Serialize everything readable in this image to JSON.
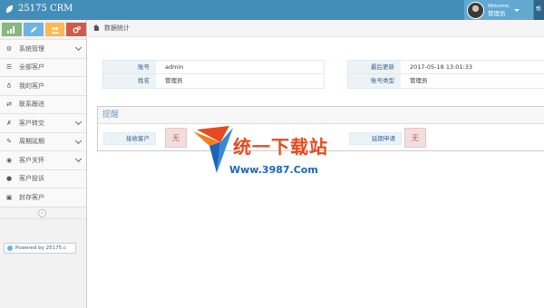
{
  "app": {
    "title": "25175 CRM"
  },
  "user": {
    "welcome": "Welcome,",
    "name": "管理员",
    "extra": "帮"
  },
  "shortcuts": [
    "bar-chart-icon",
    "pencil-icon",
    "users-icon",
    "cogs-icon"
  ],
  "sidebar": {
    "items": [
      {
        "label": "系统管理",
        "icon": "gear-icon",
        "has_submenu": true
      },
      {
        "label": "全部客户",
        "icon": "list-icon",
        "has_submenu": false
      },
      {
        "label": "我的客户",
        "icon": "bulb-icon",
        "has_submenu": false
      },
      {
        "label": "联系跟进",
        "icon": "exchange-icon",
        "has_submenu": false
      },
      {
        "label": "客户转交",
        "icon": "tools-icon",
        "has_submenu": true
      },
      {
        "label": "周期延期",
        "icon": "pencil-edit-icon",
        "has_submenu": true
      },
      {
        "label": "客户关怀",
        "icon": "eye-icon",
        "has_submenu": true
      },
      {
        "label": "客户投诉",
        "icon": "comment-icon",
        "has_submenu": false
      },
      {
        "label": "封存客户",
        "icon": "floppy-icon",
        "has_submenu": false
      }
    ],
    "collapse_symbol": "«",
    "powered_by": "Powered by 25175.c"
  },
  "breadcrumb": {
    "current": "数据统计"
  },
  "account_info": {
    "rows": [
      {
        "label": "账号",
        "value": "admin"
      },
      {
        "label": "姓名",
        "value": "管理员"
      }
    ]
  },
  "login_info": {
    "rows": [
      {
        "label": "最后更新",
        "value": "2017-05-18 13:01:33"
      },
      {
        "label": "账号类型",
        "value": "管理员"
      }
    ]
  },
  "reminder": {
    "title": "提醒",
    "items": [
      {
        "label": "接收客户",
        "value": "无"
      },
      {
        "label": "延期申请",
        "value": "无"
      }
    ]
  },
  "watermark": {
    "title": "统一下载站",
    "url": "Www.3987.Com"
  },
  "colors": {
    "navbar": "#438eb9",
    "accent": "#669fc7",
    "alert": "#d15b47"
  }
}
